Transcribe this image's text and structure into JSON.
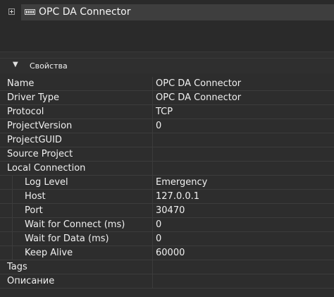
{
  "tree": {
    "nodes": [
      {
        "label": "OPC DA Connector",
        "icon": "connector-icon",
        "expanded": false,
        "selected": true
      }
    ]
  },
  "properties": {
    "category_label": "Свойства",
    "rows": [
      {
        "name": "Name",
        "value": "OPC DA Connector",
        "child": false
      },
      {
        "name": "Driver Type",
        "value": "OPC DA Connector",
        "child": false
      },
      {
        "name": "Protocol",
        "value": "TCP",
        "child": false
      },
      {
        "name": "ProjectVersion",
        "value": "0",
        "child": false
      },
      {
        "name": "ProjectGUID",
        "value": "",
        "child": false
      },
      {
        "name": "Source Project",
        "value": "",
        "child": false
      },
      {
        "name": "Local Connection",
        "value": "",
        "child": false
      },
      {
        "name": "Log Level",
        "value": "Emergency",
        "child": true
      },
      {
        "name": "Host",
        "value": "127.0.0.1",
        "child": true
      },
      {
        "name": "Port",
        "value": "30470",
        "child": true
      },
      {
        "name": "Wait for Connect (ms)",
        "value": "0",
        "child": true
      },
      {
        "name": "Wait for Data (ms)",
        "value": "0",
        "child": true
      },
      {
        "name": "Keep Alive",
        "value": "60000",
        "child": true
      },
      {
        "name": "Tags",
        "value": "",
        "child": false
      },
      {
        "name": "Описание",
        "value": "",
        "child": false
      }
    ]
  }
}
